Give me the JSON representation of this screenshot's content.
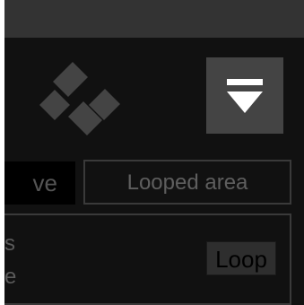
{
  "icons": {
    "logo": "diamond-arrows-logo-icon",
    "menu": "filter-menu-icon"
  },
  "colors": {
    "background": "#111111",
    "top_strip": "#333333",
    "logo": "#444444",
    "menu_button": "#444444",
    "menu_glyph": "#ffffff",
    "border": "#3a3a3a",
    "text_muted": "#5e5e5e"
  },
  "mode_selector": {
    "partial_label": "ve",
    "looped_label": "Looped area"
  },
  "panel": {
    "line1_partial": "s",
    "line2_partial": "e",
    "loop_button_label": "Loop"
  }
}
